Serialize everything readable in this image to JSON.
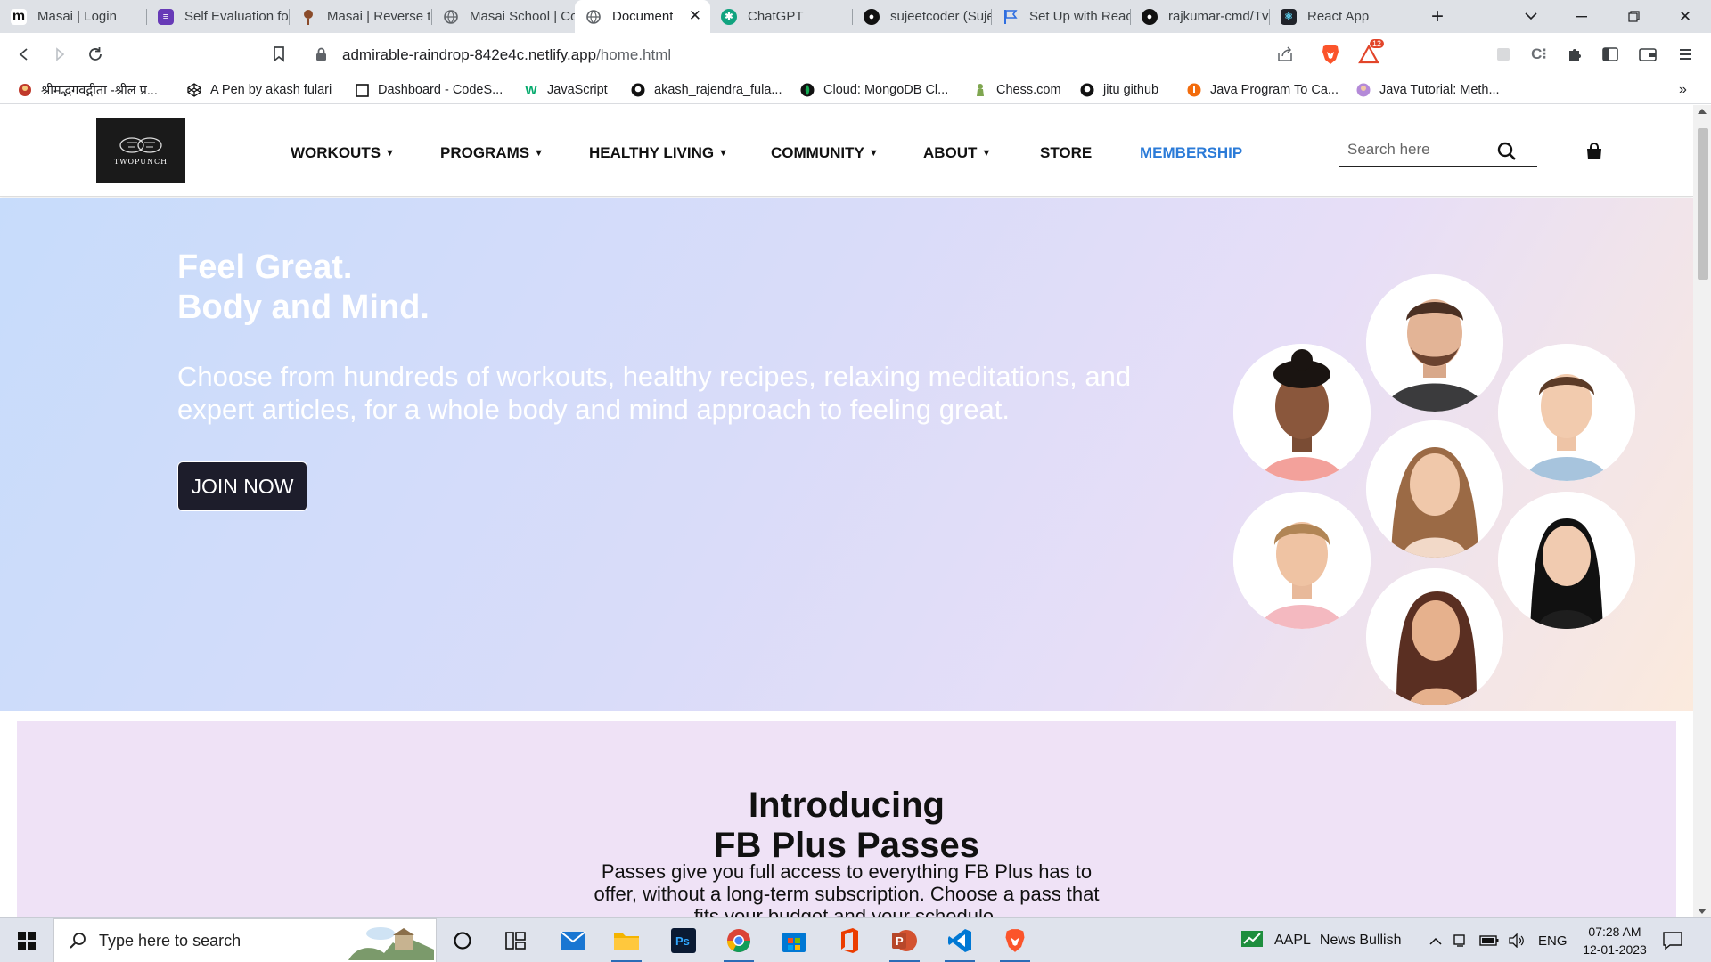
{
  "browser": {
    "tabs": [
      {
        "label": "Masai | Login",
        "icon": "m-icon",
        "color": "#111111"
      },
      {
        "label": "Self Evaluation fo",
        "icon": "forms-icon",
        "color": "#673ab7"
      },
      {
        "label": "Masai | Reverse t",
        "icon": "pin-icon",
        "color": "#8a4b2a"
      },
      {
        "label": "Masai School | Co",
        "icon": "globe-icon",
        "color": "#5f6368"
      },
      {
        "label": "Document",
        "icon": "globe-icon",
        "color": "#5f6368",
        "active": true
      },
      {
        "label": "ChatGPT",
        "icon": "openai-icon",
        "color": "#10a37f"
      },
      {
        "label": "sujeetcoder (Suje",
        "icon": "github-icon",
        "color": "#111111"
      },
      {
        "label": "Set Up with Reac",
        "icon": "flag-icon",
        "color": "#2f6ee0"
      },
      {
        "label": "rajkumar-cmd/Tv",
        "icon": "github-icon",
        "color": "#111111"
      },
      {
        "label": "React App",
        "icon": "react-icon",
        "color": "#20232a"
      }
    ],
    "url_host": "admirable-raindrop-842e4c.netlify.app",
    "url_path": "/home.html",
    "brave_badge": "12",
    "bookmarks": [
      {
        "label": "श्रीमद्भगवद्गीता -श्रील प्र...",
        "icon": "krishna-icon",
        "color": "#c0392b"
      },
      {
        "label": "A Pen by akash fulari",
        "icon": "codepen-icon",
        "color": "#111111"
      },
      {
        "label": "Dashboard - CodeS...",
        "icon": "square-icon",
        "color": "#111111"
      },
      {
        "label": "JavaScript",
        "icon": "w3-icon",
        "color": "#04aa6d"
      },
      {
        "label": "akash_rajendra_fula...",
        "icon": "github-icon",
        "color": "#111111"
      },
      {
        "label": "Cloud: MongoDB Cl...",
        "icon": "mongodb-icon",
        "color": "#13aa52"
      },
      {
        "label": "Chess.com",
        "icon": "chess-icon",
        "color": "#7fa650"
      },
      {
        "label": "jitu github",
        "icon": "github-icon",
        "color": "#111111"
      },
      {
        "label": "Java Program To Ca...",
        "icon": "java-icon",
        "color": "#f26c0d"
      },
      {
        "label": "Java Tutorial: Meth...",
        "icon": "avatar-icon",
        "color": "#8e5fb5"
      }
    ]
  },
  "site": {
    "logo_text": "TWOPUNCH",
    "nav": [
      {
        "label": "WORKOUTS",
        "dropdown": true
      },
      {
        "label": "PROGRAMS",
        "dropdown": true
      },
      {
        "label": "HEALTHY LIVING",
        "dropdown": true
      },
      {
        "label": "COMMUNITY",
        "dropdown": true
      },
      {
        "label": "ABOUT",
        "dropdown": true
      },
      {
        "label": "STORE",
        "dropdown": false
      },
      {
        "label": "MEMBERSHIP",
        "dropdown": false
      }
    ],
    "search_placeholder": "Search here",
    "hero": {
      "line1": "Feel Great.",
      "line2": "Body and Mind.",
      "text": "Choose from hundreds of workouts, healthy recipes, relaxing meditations, and expert articles, for a whole body and mind approach to feeling great.",
      "cta": "JOIN NOW"
    },
    "intro": {
      "line1": "Introducing",
      "line2": "FB Plus Passes",
      "text": "Passes give you full access to everything FB Plus has to offer, without a long-term subscription. Choose a pass that fits your budget and your schedule."
    }
  },
  "taskbar": {
    "search_placeholder": "Type here to search",
    "apps": [
      "cortana-icon",
      "task-view-icon",
      "mail-icon",
      "file-explorer-icon",
      "photoshop-icon",
      "chrome-icon",
      "store-icon",
      "office-icon",
      "powerpoint-icon",
      "vscode-icon",
      "brave-icon"
    ],
    "news_ticker": "AAPL",
    "news_text": "News Bullish",
    "language": "ENG",
    "time": "07:28 AM",
    "date": "12-01-2023"
  },
  "colors": {
    "membership": "#2b7bd8",
    "join_button": "#1d1d2b",
    "intro_bg": "#efe2f6"
  }
}
